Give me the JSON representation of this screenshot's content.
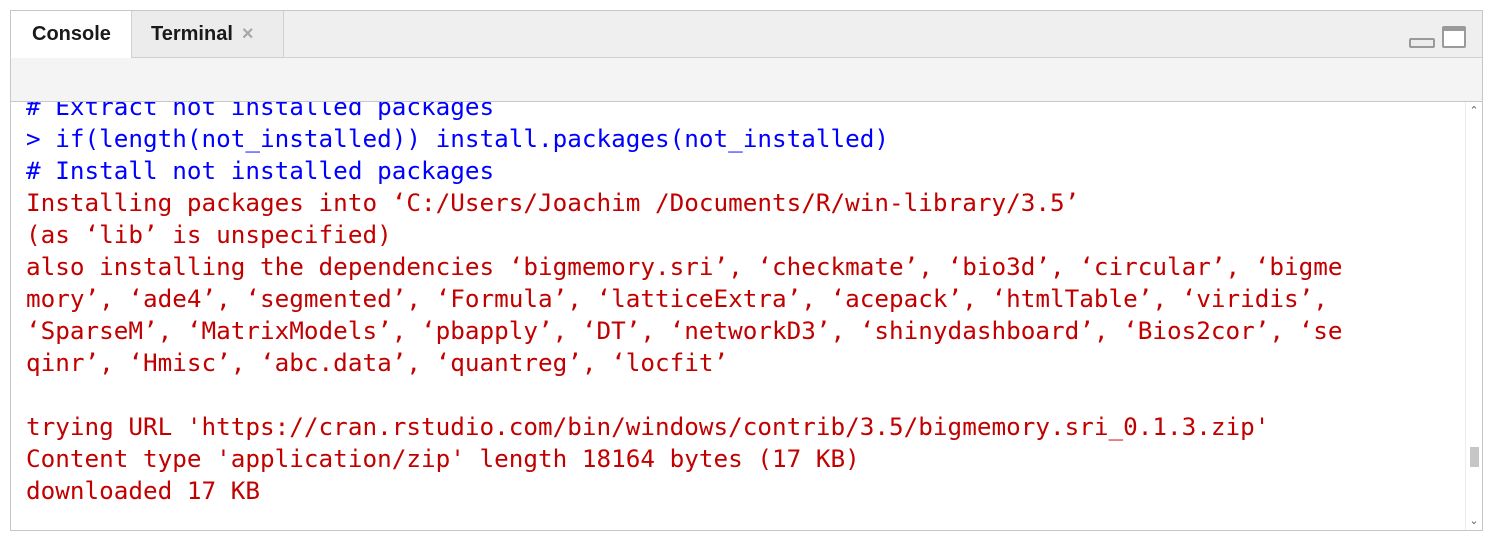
{
  "tabs": [
    {
      "label": "Console",
      "active": true
    },
    {
      "label": "Terminal",
      "active": false,
      "close_glyph": "×"
    }
  ],
  "window_controls": {
    "minimize_icon": "minimize-icon",
    "maximize_icon": "maximize-icon"
  },
  "console": {
    "lines": [
      {
        "text": "# Extract not installed packages",
        "kind": "input"
      },
      {
        "text": "> if(length(not_installed)) install.packages(not_installed)",
        "kind": "input"
      },
      {
        "text": "# Install not installed packages",
        "kind": "input"
      },
      {
        "text": "Installing packages into ‘C:/Users/Joachim /Documents/R/win-library/3.5’",
        "kind": "output"
      },
      {
        "text": "(as ‘lib’ is unspecified)",
        "kind": "output"
      },
      {
        "text": "also installing the dependencies ‘bigmemory.sri’, ‘checkmate’, ‘bio3d’, ‘circular’, ‘bigme",
        "kind": "output"
      },
      {
        "text": "mory’, ‘ade4’, ‘segmented’, ‘Formula’, ‘latticeExtra’, ‘acepack’, ‘htmlTable’, ‘viridis’,",
        "kind": "output"
      },
      {
        "text": "‘SparseM’, ‘MatrixModels’, ‘pbapply’, ‘DT’, ‘networkD3’, ‘shinydashboard’, ‘Bios2cor’, ‘se",
        "kind": "output"
      },
      {
        "text": "qinr’, ‘Hmisc’, ‘abc.data’, ‘quantreg’, ‘locfit’",
        "kind": "output"
      },
      {
        "text": "",
        "kind": "output"
      },
      {
        "text": "trying URL 'https://cran.rstudio.com/bin/windows/contrib/3.5/bigmemory.sri_0.1.3.zip'",
        "kind": "output"
      },
      {
        "text": "Content type 'application/zip' length 18164 bytes (17 KB)",
        "kind": "output"
      },
      {
        "text": "downloaded 17 KB",
        "kind": "output"
      }
    ]
  },
  "colors": {
    "input": "#0000ff",
    "output": "#c10000"
  },
  "scrollbar": {
    "up_glyph": "⌃",
    "down_glyph": "⌄"
  }
}
